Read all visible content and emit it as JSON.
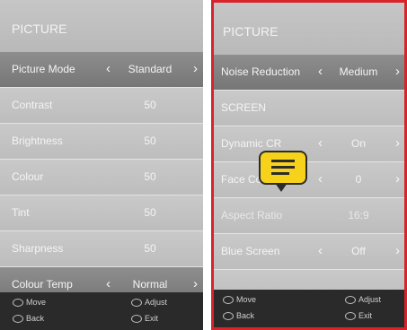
{
  "left": {
    "title": "PICTURE",
    "rows": [
      {
        "label": "Picture Mode",
        "value": "Standard",
        "arrows": true,
        "selected": false
      },
      {
        "label": "Contrast",
        "value": "50"
      },
      {
        "label": "Brightness",
        "value": "50"
      },
      {
        "label": "Colour",
        "value": "50"
      },
      {
        "label": "Tint",
        "value": "50"
      },
      {
        "label": "Sharpness",
        "value": "50"
      },
      {
        "label": "Colour Temp",
        "value": "Normal",
        "arrows": true,
        "selected": true
      }
    ],
    "footer": {
      "move": "Move",
      "adjust": "Adjust",
      "back": "Back",
      "exit": "Exit"
    }
  },
  "right": {
    "title": "PICTURE",
    "rows": [
      {
        "label": "Noise Reduction",
        "value": "Medium",
        "arrows": true,
        "selected": true
      },
      {
        "label": "SCREEN",
        "value": "",
        "section": true
      },
      {
        "label": "Dynamic CR",
        "value": "On",
        "arrows": true
      },
      {
        "label": "Face Colour",
        "value": "0",
        "arrows": true
      },
      {
        "label": "Aspect Ratio",
        "value": "16:9",
        "dim": true
      },
      {
        "label": "Blue Screen",
        "value": "Off",
        "arrows": true
      }
    ],
    "footer": {
      "move": "Move",
      "adjust": "Adjust",
      "back": "Back",
      "exit": "Exit"
    }
  },
  "arrow_left": "‹",
  "arrow_right": "›",
  "highlight_color": "#d9232a",
  "bubble_icon": "speech-bubble-icon"
}
